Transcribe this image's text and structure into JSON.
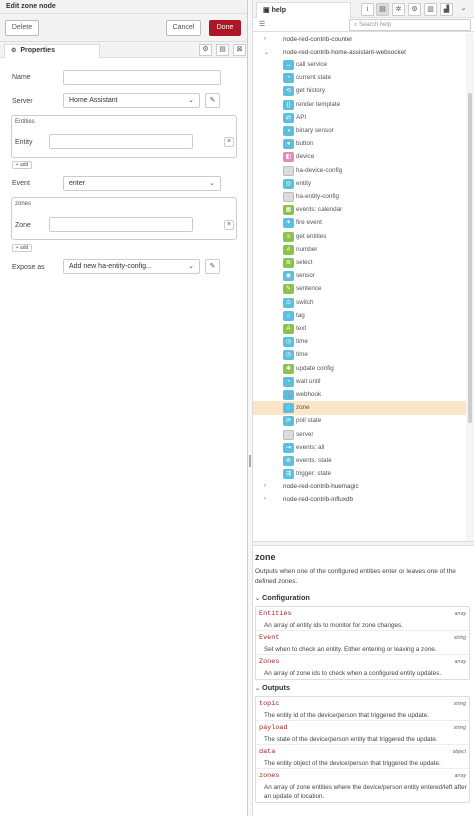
{
  "tray": {
    "title": "Edit zone node",
    "delete_label": "Delete",
    "cancel_label": "Cancel",
    "done_label": "Done",
    "tab_label": "Properties"
  },
  "form": {
    "name_label": "Name",
    "name_value": "",
    "server_label": "Server",
    "server_value": "Home Assistant",
    "entities_title": "Entities",
    "entity_label": "Entity",
    "entity_value": "",
    "add_label": "add",
    "event_label": "Event",
    "event_value": "enter",
    "zones_title": "zones",
    "zone_label": "Zone",
    "zone_value": "",
    "add2_label": "add",
    "expose_label": "Expose as",
    "expose_value": "Add new ha-entity-config..."
  },
  "sidebar": {
    "tab_label": "help",
    "search_placeholder": "Search help",
    "tree": [
      {
        "type": "group",
        "label": "node-red-contrib-counter",
        "expanded": false
      },
      {
        "type": "group",
        "label": "node-red-contrib-home-assistant-websocket",
        "expanded": true
      },
      {
        "type": "node",
        "label": "call service",
        "color": "#5bc0de",
        "icon": "↔"
      },
      {
        "type": "node",
        "label": "current state",
        "color": "#5bc0de",
        "icon": "◔"
      },
      {
        "type": "node",
        "label": "get history",
        "color": "#5bc0de",
        "icon": "⟲"
      },
      {
        "type": "node",
        "label": "render template",
        "color": "#5bc0de",
        "icon": "{}"
      },
      {
        "type": "node",
        "label": "API",
        "color": "#5bc0de",
        "icon": "⇄"
      },
      {
        "type": "node",
        "label": "binary sensor",
        "color": "#5bc0de",
        "icon": "◑"
      },
      {
        "type": "node",
        "label": "button",
        "color": "#5bc0de",
        "icon": "●"
      },
      {
        "type": "node",
        "label": "device",
        "color": "#e38ab8",
        "icon": "◧"
      },
      {
        "type": "node",
        "label": "ha-device-config",
        "color": "#dddddd",
        "icon": ""
      },
      {
        "type": "node",
        "label": "entity",
        "color": "#5bc0de",
        "icon": "◎"
      },
      {
        "type": "node",
        "label": "ha-entity-config",
        "color": "#dddddd",
        "icon": ""
      },
      {
        "type": "node",
        "label": "events: calendar",
        "color": "#8bc34a",
        "icon": "▦"
      },
      {
        "type": "node",
        "label": "fire event",
        "color": "#5bc0de",
        "icon": "✦"
      },
      {
        "type": "node",
        "label": "get entities",
        "color": "#8bc34a",
        "icon": "≡"
      },
      {
        "type": "node",
        "label": "number",
        "color": "#8bc34a",
        "icon": "#"
      },
      {
        "type": "node",
        "label": "select",
        "color": "#8bc34a",
        "icon": "≣"
      },
      {
        "type": "node",
        "label": "sensor",
        "color": "#5bc0de",
        "icon": "◉"
      },
      {
        "type": "node",
        "label": "sentence",
        "color": "#8bc34a",
        "icon": "✎"
      },
      {
        "type": "node",
        "label": "switch",
        "color": "#5bc0de",
        "icon": "⊙"
      },
      {
        "type": "node",
        "label": "tag",
        "color": "#5bc0de",
        "icon": "⌂"
      },
      {
        "type": "node",
        "label": "text",
        "color": "#8bc34a",
        "icon": "A"
      },
      {
        "type": "node",
        "label": "time",
        "color": "#5bc0de",
        "icon": "◷"
      },
      {
        "type": "node",
        "label": "time",
        "color": "#5bc0de",
        "icon": "◷"
      },
      {
        "type": "node",
        "label": "update config",
        "color": "#8bc34a",
        "icon": "✱"
      },
      {
        "type": "node",
        "label": "wait until",
        "color": "#5bc0de",
        "icon": "◔"
      },
      {
        "type": "node",
        "label": "webhook",
        "color": "#5bc0de",
        "icon": "⚓"
      },
      {
        "type": "node",
        "label": "zone",
        "color": "#5bc0de",
        "icon": "◌",
        "selected": true
      },
      {
        "type": "node",
        "label": "poll state",
        "color": "#5bc0de",
        "icon": "⟳"
      },
      {
        "type": "node",
        "label": "server",
        "color": "#dddddd",
        "icon": ""
      },
      {
        "type": "node",
        "label": "events: all",
        "color": "#5bc0de",
        "icon": "⇥"
      },
      {
        "type": "node",
        "label": "events: state",
        "color": "#5bc0de",
        "icon": "⊚"
      },
      {
        "type": "node",
        "label": "trigger: state",
        "color": "#5bc0de",
        "icon": "⇶"
      },
      {
        "type": "group",
        "label": "node-red-contrib-huemagic",
        "expanded": false
      },
      {
        "type": "group",
        "label": "node-red-contrib-influxdb",
        "expanded": false
      }
    ]
  },
  "doc": {
    "title": "zone",
    "intro": "Outputs when one of the configured entities enter or leaves one of the defined zones.",
    "config_heading": "Configuration",
    "config": [
      {
        "name": "Entities",
        "type": "array",
        "desc": "An array of entity ids to monitor for zone changes."
      },
      {
        "name": "Event",
        "type": "string",
        "desc": "Set when to check an entity. Either entering or leaving a zone."
      },
      {
        "name": "Zones",
        "type": "array",
        "desc": "An array of zone ids to check when a configured entity updates."
      }
    ],
    "outputs_heading": "Outputs",
    "outputs": [
      {
        "name": "topic",
        "type": "string",
        "desc": "The entity id of the device/person that triggered the update."
      },
      {
        "name": "payload",
        "type": "string",
        "desc": "The state of the device/person entity that triggered the update."
      },
      {
        "name": "data",
        "type": "object",
        "desc": "The entity object of the device/person that triggered the update."
      },
      {
        "name": "zones",
        "type": "array",
        "desc": "An array of zone entities where the device/person entity entered/left after an update of location."
      }
    ]
  },
  "icons": {
    "tab_gear": "gear-icon",
    "tab_description": "description-icon",
    "tab_appearance": "appearance-icon",
    "pencil": "pencil-icon",
    "remove": "close-icon",
    "info": "info-icon",
    "book": "book-icon",
    "debug": "bug-icon",
    "config": "gear-icon",
    "context": "context-icon",
    "dashboard": "chart-icon"
  },
  "colors": {
    "done_button": "#ad1625",
    "selected_row": "#fbe6c8",
    "prop_name": "#aa2222"
  }
}
